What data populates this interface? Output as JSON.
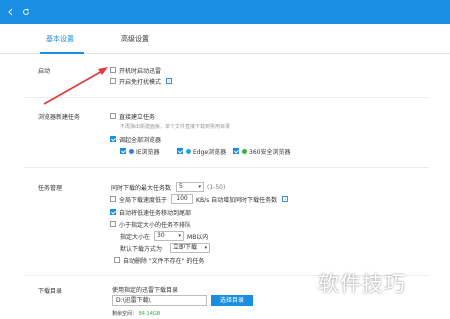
{
  "window": {
    "back_icon": "chevron-left-icon",
    "refresh_icon": "refresh-icon"
  },
  "tabs": [
    {
      "label": "基本设置",
      "active": true
    },
    {
      "label": "高级设置",
      "active": false
    }
  ],
  "sections": {
    "startup": {
      "label": "启动",
      "options": [
        {
          "label": "开机时启动迅雷",
          "checked": false
        },
        {
          "label": "开启免打扰模式",
          "checked": false
        }
      ]
    },
    "browser": {
      "label": "浏览器新建任务",
      "options": [
        {
          "label": "直接建立任务",
          "checked": false
        },
        {
          "label": "调起全部浏览器",
          "checked": true
        }
      ],
      "note": "不再弹出新建面板，单个文件直接下载到常用目录",
      "browsers": [
        {
          "label": "IE浏览器",
          "checked": true
        },
        {
          "label": "Edge浏览器",
          "checked": true
        },
        {
          "label": "360安全浏览器",
          "checked": true
        }
      ]
    },
    "tasks": {
      "label": "任务管理",
      "max_downloads_label": "同时下载的最大任务数",
      "max_downloads_value": "5",
      "max_downloads_range": "(1-50)",
      "speed_prefix": "全局下载速度低于",
      "speed_value": "100",
      "speed_suffix": "KB/s 自动增加同时下载任务数",
      "auto_move_label": "自动将低速任务移动到尾部",
      "auto_move_checked": true,
      "small_tasks_label": "小于指定大小的任务不排队",
      "small_tasks_checked": false,
      "size_prefix": "指定大小在",
      "size_value": "30",
      "size_unit": "MB以内",
      "default_mode_label": "默认下载方式为",
      "default_mode_value": "立即下载",
      "auto_delete_label": "自动删除 \"文件不存在\" 的任务",
      "auto_delete_checked": false
    },
    "download_dir": {
      "label": "下载目录",
      "note": "使用指定的迅雷下载目录",
      "path_value": "D:\\迅雷下载\\",
      "browse_label": "选择目录",
      "space_label": "剩余空间：",
      "space_value": "84.14GB"
    }
  },
  "watermark": "软件技巧",
  "colors": {
    "accent": "#1a8ee0",
    "annotation_arrow": "#e23b3b"
  }
}
